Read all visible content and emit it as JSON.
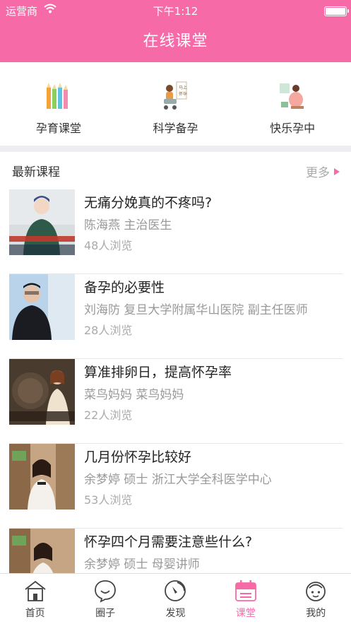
{
  "status": {
    "carrier": "运营商",
    "time": "下午1:12"
  },
  "header": {
    "title": "在线课堂"
  },
  "categories": [
    {
      "label": "孕育课堂",
      "icon": "pencils-icon"
    },
    {
      "label": "科学备孕",
      "icon": "mother-stroller-icon"
    },
    {
      "label": "快乐孕中",
      "icon": "pregnant-mother-icon"
    }
  ],
  "section": {
    "title": "最新课程",
    "more": "更多"
  },
  "courses": [
    {
      "title": "无痛分娩真的不疼吗?",
      "author": "陈海燕  主治医生",
      "views": "48人浏览"
    },
    {
      "title": "备孕的必要性",
      "author": "刘海防  复旦大学附属华山医院 副主任医师",
      "views": "28人浏览"
    },
    {
      "title": "算准排卵日，提高怀孕率",
      "author": "菜鸟妈妈  菜鸟妈妈",
      "views": "22人浏览"
    },
    {
      "title": "几月份怀孕比较好",
      "author": "余梦婷  硕士  浙江大学全科医学中心",
      "views": "53人浏览"
    },
    {
      "title": "怀孕四个月需要注意些什么?",
      "author": "余梦婷  硕士  母婴讲师",
      "views": ""
    }
  ],
  "tabs": [
    {
      "label": "首页",
      "icon": "home-icon"
    },
    {
      "label": "圈子",
      "icon": "chat-bubble-icon"
    },
    {
      "label": "发现",
      "icon": "compass-icon"
    },
    {
      "label": "课堂",
      "icon": "calendar-icon",
      "active": true
    },
    {
      "label": "我的",
      "icon": "face-icon"
    }
  ],
  "colors": {
    "accent": "#f76aa8",
    "divider": "#eeeef2"
  }
}
